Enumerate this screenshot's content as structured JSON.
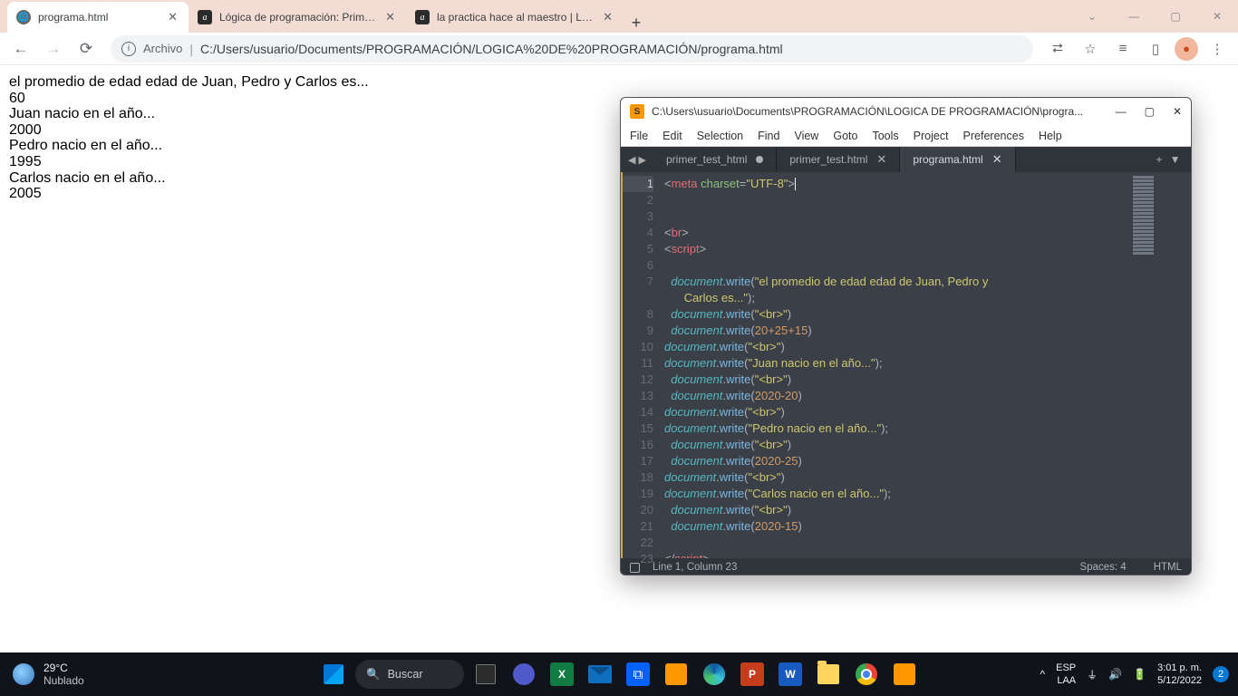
{
  "chrome": {
    "tabs": [
      {
        "title": "programa.html",
        "fav": "globe",
        "active": true
      },
      {
        "title": "Lógica de programación: Primero",
        "fav": "a",
        "active": false
      },
      {
        "title": "la practica hace al maestro | Lógi",
        "fav": "a",
        "active": false
      }
    ],
    "newtab": "+",
    "window": {
      "chevdown": "⌄",
      "min": "—",
      "max": "▢",
      "close": "✕"
    },
    "nav": {
      "back": "←",
      "fwd": "→",
      "reload": "⟳"
    },
    "omnibox": {
      "archivo": "Archivo",
      "url": "C:/Users/usuario/Documents/PROGRAMACIÓN/LOGICA%20DE%20PROGRAMACIÓN/programa.html"
    },
    "icons": {
      "share": "⮂",
      "star": "☆",
      "list": "≡",
      "panel": "▯",
      "menu": "⋮"
    }
  },
  "page": {
    "lines": [
      "el promedio de edad edad de Juan, Pedro y Carlos es...",
      "60",
      "Juan nacio en el año...",
      "2000",
      "Pedro nacio en el año...",
      "1995",
      "Carlos nacio en el año...",
      "2005"
    ]
  },
  "sublime": {
    "title": "C:\\Users\\usuario\\Documents\\PROGRAMACIÓN\\LOGICA DE PROGRAMACIÓN\\progra...",
    "menu": [
      "File",
      "Edit",
      "Selection",
      "Find",
      "View",
      "Goto",
      "Tools",
      "Project",
      "Preferences",
      "Help"
    ],
    "tabs": [
      {
        "name": "primer_test_html",
        "dirty": true,
        "active": false
      },
      {
        "name": "primer_test.html",
        "dirty": false,
        "active": false
      },
      {
        "name": "programa.html",
        "dirty": false,
        "active": true
      }
    ],
    "code": {
      "lines": [
        {
          "n": 1,
          "kind": "meta",
          "attr": "charset",
          "val": "UTF-8",
          "cur": true
        },
        {
          "n": 2,
          "kind": "blank"
        },
        {
          "n": 3,
          "kind": "blank"
        },
        {
          "n": 4,
          "kind": "tag",
          "tag": "br"
        },
        {
          "n": 5,
          "kind": "tag",
          "tag": "script"
        },
        {
          "n": 6,
          "kind": "blank"
        },
        {
          "n": 7,
          "kind": "dw1",
          "indent": "  ",
          "str": "el promedio de edad edad de Juan, Pedro y"
        },
        {
          "n": "",
          "kind": "cont",
          "indent": "      ",
          "str": "Carlos es...",
          "end": true
        },
        {
          "n": 8,
          "kind": "dws",
          "indent": "  ",
          "str": "<br>"
        },
        {
          "n": 9,
          "kind": "dwn",
          "indent": "  ",
          "num": "20+25+15"
        },
        {
          "n": 10,
          "kind": "dws",
          "indent": "",
          "str": "<br>"
        },
        {
          "n": 11,
          "kind": "dws",
          "indent": "",
          "str": "Juan nacio en el año...",
          "end": true
        },
        {
          "n": 12,
          "kind": "dws",
          "indent": "  ",
          "str": "<br>"
        },
        {
          "n": 13,
          "kind": "dwn",
          "indent": "  ",
          "num": "2020-20"
        },
        {
          "n": 14,
          "kind": "dws",
          "indent": "",
          "str": "<br>"
        },
        {
          "n": 15,
          "kind": "dws",
          "indent": "",
          "str": "Pedro nacio en el año...",
          "end": true
        },
        {
          "n": 16,
          "kind": "dws",
          "indent": "  ",
          "str": "<br>"
        },
        {
          "n": 17,
          "kind": "dwn",
          "indent": "  ",
          "num": "2020-25"
        },
        {
          "n": 18,
          "kind": "dws",
          "indent": "",
          "str": "<br>"
        },
        {
          "n": 19,
          "kind": "dws",
          "indent": "",
          "str": "Carlos nacio en el año...",
          "end": true
        },
        {
          "n": 20,
          "kind": "dws",
          "indent": "  ",
          "str": "<br>"
        },
        {
          "n": 21,
          "kind": "dwn",
          "indent": "  ",
          "num": "2020-15"
        },
        {
          "n": 22,
          "kind": "blank"
        },
        {
          "n": 23,
          "kind": "ctag",
          "tag": "script"
        }
      ]
    },
    "status": {
      "pos": "Line 1, Column 23",
      "spaces": "Spaces: 4",
      "lang": "HTML"
    }
  },
  "taskbar": {
    "weather": {
      "temp": "29°C",
      "desc": "Nublado"
    },
    "search": "Buscar",
    "lang": {
      "l1": "ESP",
      "l2": "LAA"
    },
    "clock": {
      "time": "3:01 p. m.",
      "date": "5/12/2022"
    },
    "badge": "2",
    "tray": {
      "up": "^",
      "wifi": "⏚",
      "vol": "🔊",
      "bat": "🔋"
    }
  }
}
